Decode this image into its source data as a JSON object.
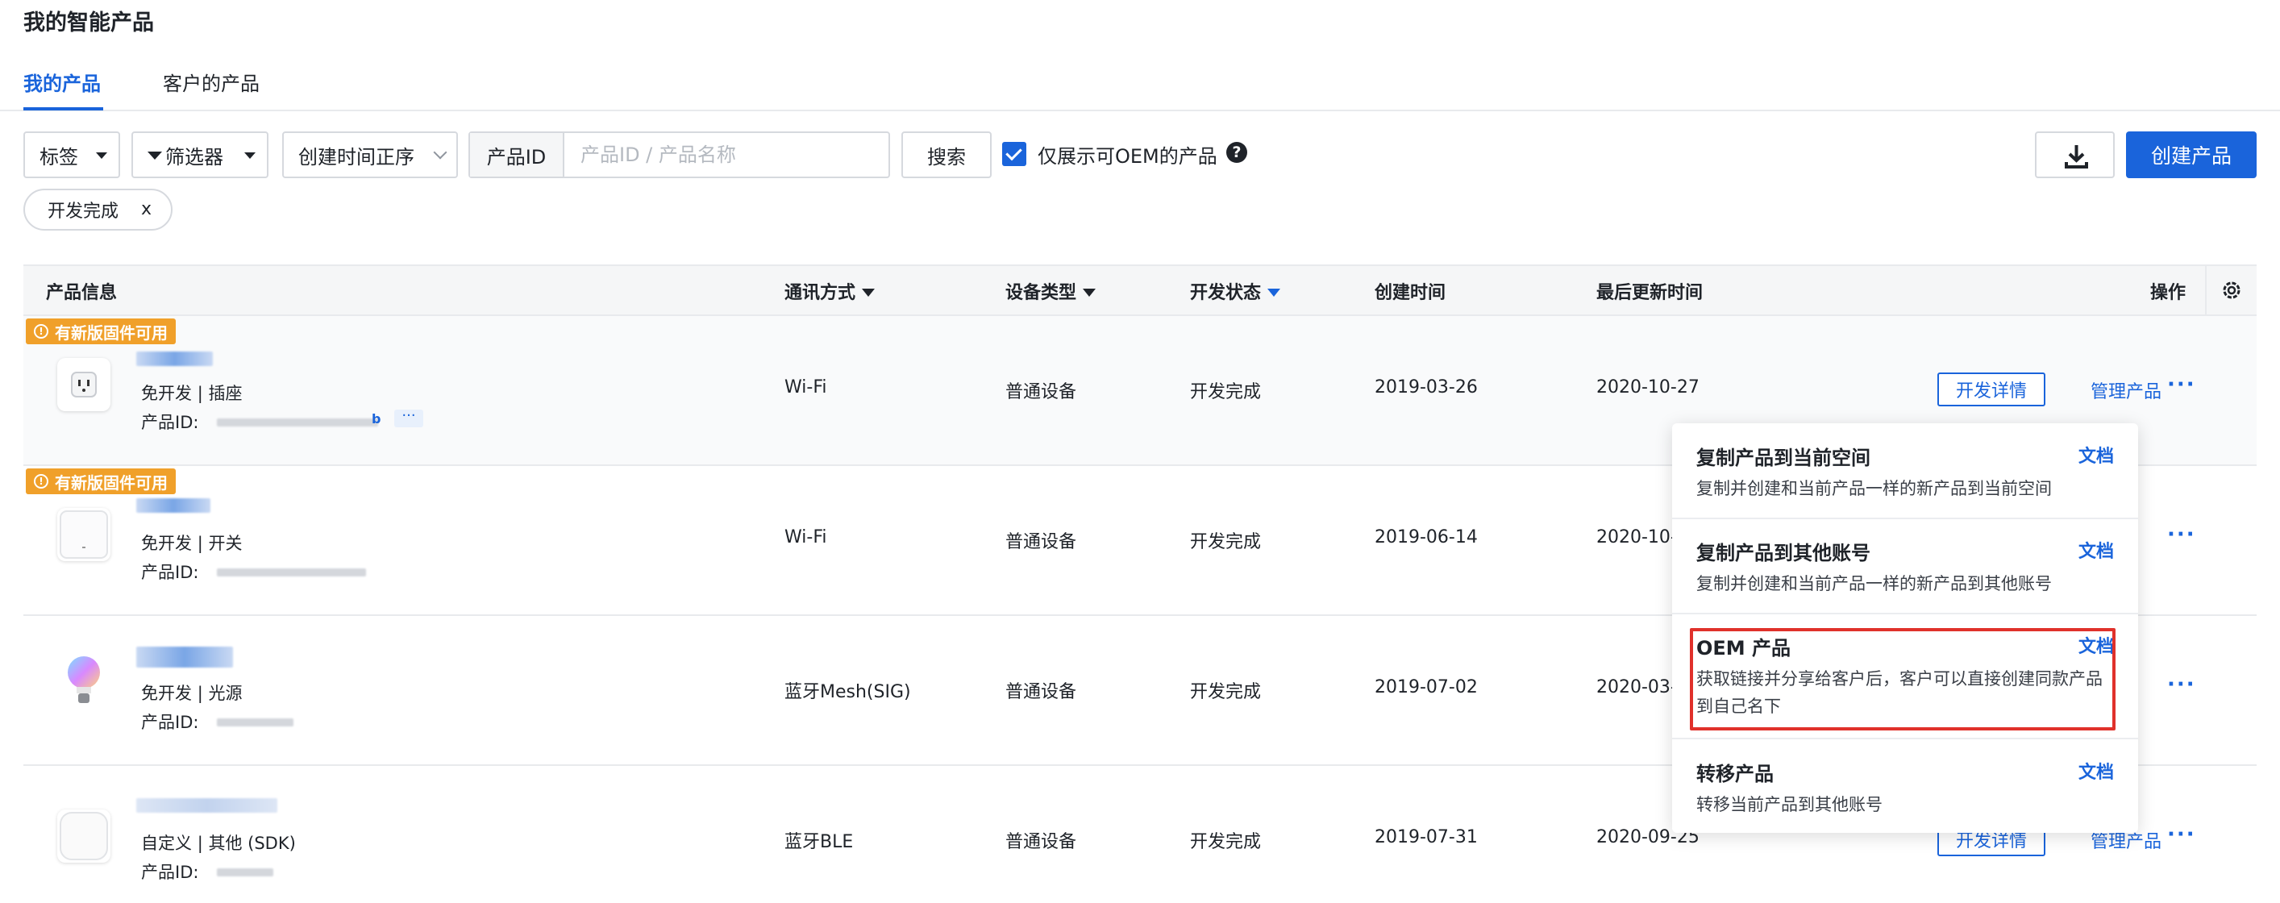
{
  "page": {
    "title": "我的智能产品"
  },
  "tabs": [
    {
      "label": "我的产品"
    },
    {
      "label": "客户的产品"
    }
  ],
  "toolbar": {
    "tag_select": "标签",
    "filter_select": "筛选器",
    "sort_select": "创建时间正序",
    "search_field_label": "产品ID",
    "search_placeholder": "产品ID / 产品名称",
    "search_button": "搜索",
    "oem_only_label": "仅展示可OEM的产品",
    "help_icon": "?",
    "create_button": "创建产品"
  },
  "active_filter_chip": {
    "label": "开发完成",
    "close": "x"
  },
  "table": {
    "columns": {
      "info": "产品信息",
      "protocol": "通讯方式",
      "device_type": "设备类型",
      "dev_status": "开发状态",
      "created": "创建时间",
      "updated": "最后更新时间",
      "actions": "操作"
    },
    "badge_text": "有新版固件可用",
    "id_label": "产品ID:",
    "separator": "|",
    "rows": [
      {
        "dev_mode": "免开发",
        "category": "插座",
        "protocol": "Wi-Fi",
        "device_type": "普通设备",
        "status": "开发完成",
        "created": "2019-03-26",
        "updated": "2020-10-27",
        "has_badge": true
      },
      {
        "dev_mode": "免开发",
        "category": "开关",
        "protocol": "Wi-Fi",
        "device_type": "普通设备",
        "status": "开发完成",
        "created": "2019-06-14",
        "updated": "2020-10-",
        "has_badge": true
      },
      {
        "dev_mode": "免开发",
        "category": "光源",
        "protocol": "蓝牙Mesh(SIG)",
        "device_type": "普通设备",
        "status": "开发完成",
        "created": "2019-07-02",
        "updated": "2020-03-",
        "has_badge": false
      },
      {
        "dev_mode": "自定义",
        "category": "其他 (SDK)",
        "protocol": "蓝牙BLE",
        "device_type": "普通设备",
        "status": "开发完成",
        "created": "2019-07-31",
        "updated": "2020-09-25",
        "has_badge": false
      }
    ],
    "row_actions": {
      "detail_button": "开发详情",
      "manage_link": "管理产品",
      "more": "···",
      "id_more": "···"
    }
  },
  "manage_menu": {
    "items": [
      {
        "title": "复制产品到当前空间",
        "desc": "复制并创建和当前产品一样的新产品到当前空间",
        "doc": "文档"
      },
      {
        "title": "复制产品到其他账号",
        "desc": "复制并创建和当前产品一样的新产品到其他账号",
        "doc": "文档"
      },
      {
        "title": "OEM 产品",
        "desc": "获取链接并分享给客户后，客户可以直接创建同款产品到自己名下",
        "doc": "文档",
        "highlighted": true
      },
      {
        "title": "转移产品",
        "desc": "转移当前产品到其他账号",
        "doc": "文档"
      }
    ]
  },
  "colors": {
    "accent": "#1a64db",
    "badge": "#f0a02a",
    "highlight_border": "#e0312b"
  }
}
